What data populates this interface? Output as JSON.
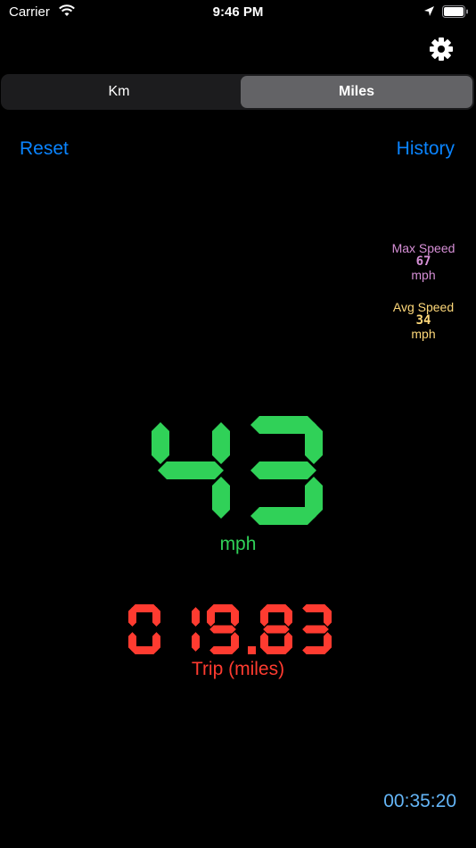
{
  "status_bar": {
    "carrier": "Carrier",
    "time": "9:46 PM"
  },
  "units": {
    "options": [
      "Km",
      "Miles"
    ],
    "selected": "Miles"
  },
  "actions": {
    "reset": "Reset",
    "history": "History"
  },
  "stats": {
    "max_speed": {
      "label": "Max Speed",
      "value": "67",
      "unit": "mph"
    },
    "avg_speed": {
      "label": "Avg Speed",
      "value": "34",
      "unit": "mph"
    }
  },
  "speed": {
    "value": "43",
    "unit": "mph"
  },
  "trip": {
    "value": "019.83",
    "label": "Trip (miles)"
  },
  "timer": "00:35:20",
  "colors": {
    "speed": "#30d158",
    "trip": "#ff3b30",
    "link": "#0a84ff",
    "max": "#d68fd6",
    "avg": "#ffd97a",
    "timer": "#64b5f6"
  }
}
